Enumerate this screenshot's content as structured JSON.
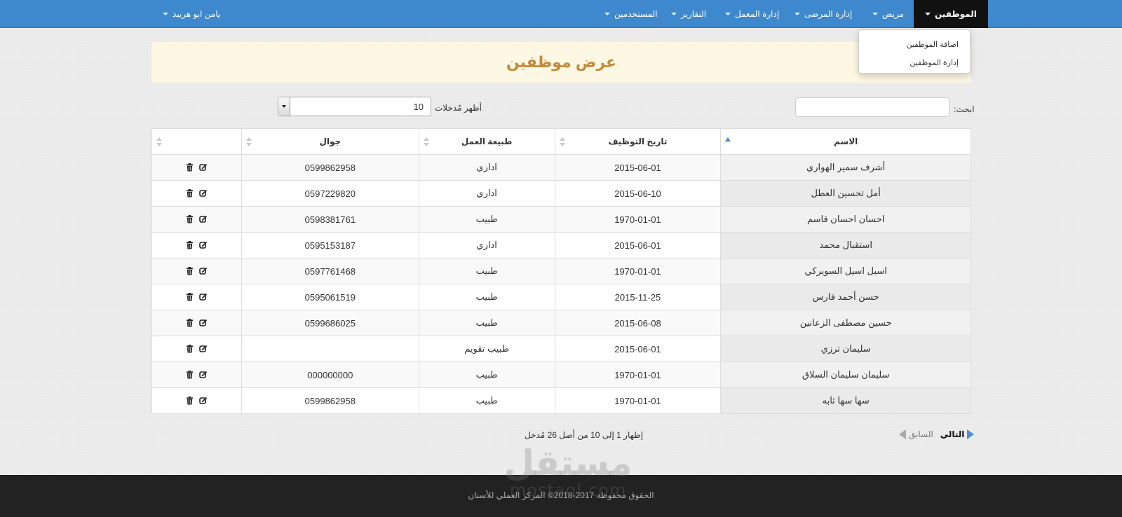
{
  "nav": {
    "items": [
      {
        "label": "الموظفين"
      },
      {
        "label": "مريض"
      },
      {
        "label": "إدارة المرضى"
      },
      {
        "label": "إدارة المعمل"
      },
      {
        "label": "التقارير"
      },
      {
        "label": "المستخدمين"
      }
    ],
    "user": "يامن ابو هريبد"
  },
  "dropdown": {
    "items": [
      "اضافة الموظفين",
      "إدارة الموظفين"
    ]
  },
  "page": {
    "title": "عرض موظفين"
  },
  "controls": {
    "search_label": "ابحث:",
    "search_value": "",
    "length_label": "أظهر مُدخلات",
    "length_value": "10"
  },
  "table": {
    "headers": {
      "name": "الاسم",
      "hire_date": "تاريخ التوظيف",
      "job_type": "طبيعة العمل",
      "mobile": "جوال",
      "actions": ""
    },
    "rows": [
      {
        "name": "أشرف سمير الهواري",
        "hire_date": "2015-06-01",
        "job_type": "اداري",
        "mobile": "0599862958"
      },
      {
        "name": "أمل تحسين العطل",
        "hire_date": "2015-06-10",
        "job_type": "اداري",
        "mobile": "0597229820"
      },
      {
        "name": "احسان احسان قاسم",
        "hire_date": "1970-01-01",
        "job_type": "طبيب",
        "mobile": "0598381761"
      },
      {
        "name": "استقبال محمد",
        "hire_date": "2015-06-01",
        "job_type": "اداري",
        "mobile": "0595153187"
      },
      {
        "name": "اسيل اسيل السويركي",
        "hire_date": "1970-01-01",
        "job_type": "طبيب",
        "mobile": "0597761468"
      },
      {
        "name": "حسن أحمد فارس",
        "hire_date": "2015-11-25",
        "job_type": "طبيب",
        "mobile": "0595061519"
      },
      {
        "name": "حسين مصطفى الزعانين",
        "hire_date": "2015-06-08",
        "job_type": "طبيب",
        "mobile": "0599686025"
      },
      {
        "name": "سليمان ترزي",
        "hire_date": "2015-06-01",
        "job_type": "طبيب تقويم",
        "mobile": ""
      },
      {
        "name": "سليمان سليمان السلاق",
        "hire_date": "1970-01-01",
        "job_type": "طبيب",
        "mobile": "000000000"
      },
      {
        "name": "سها سها ثابه",
        "hire_date": "1970-01-01",
        "job_type": "طبيب",
        "mobile": "0599862958"
      }
    ]
  },
  "info": {
    "text": "إظهار 1 إلى 10 من أصل 26 مُدخل"
  },
  "pagination": {
    "next": "التالي",
    "previous": "السابق"
  },
  "footer": {
    "text": "الحقوق محفوظة 2017-2018© المركز العملي للأسنان"
  },
  "watermark": {
    "arabic": "مستقل",
    "latin": "mostaql.com"
  },
  "colors": {
    "navbar": "#3e88cd",
    "active_nav": "#111111",
    "title": "#c48a3c",
    "header_bg": "#fcf8e3",
    "footer": "#222222"
  }
}
